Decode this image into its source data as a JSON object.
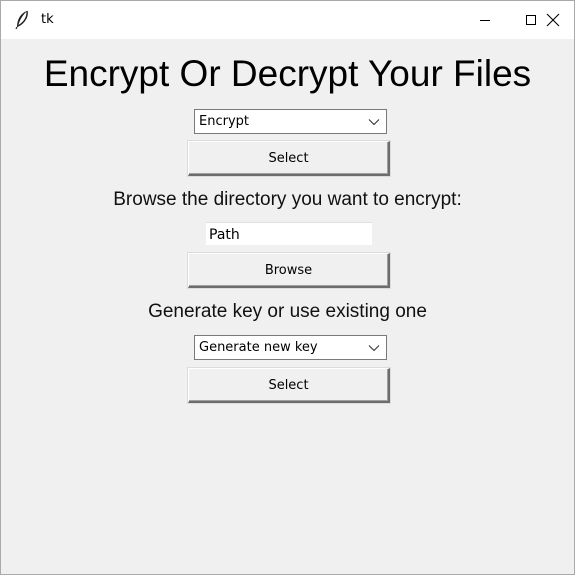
{
  "window": {
    "title": "tk"
  },
  "heading": "Encrypt Or Decrypt Your Files",
  "mode_select": {
    "value": "Encrypt",
    "button_label": "Select"
  },
  "browse": {
    "label": "Browse the directory you want to encrypt:",
    "path_value": "Path",
    "button_label": "Browse"
  },
  "key": {
    "label": "Generate key or use existing one",
    "value": "Generate new key",
    "button_label": "Select"
  },
  "icons": {
    "app": "feather-icon",
    "minimize": "minimize-icon",
    "maximize": "maximize-icon",
    "close": "close-icon",
    "dropdown": "chevron-down-icon"
  }
}
